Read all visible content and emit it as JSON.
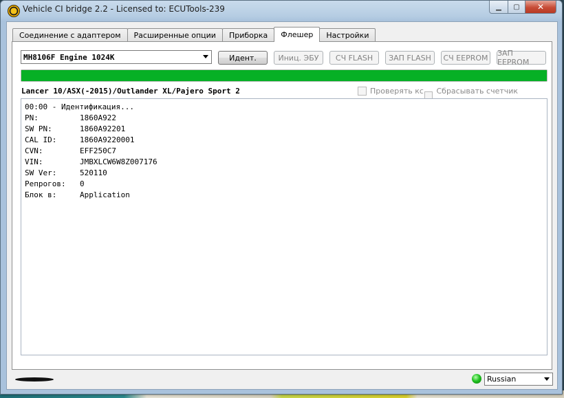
{
  "window": {
    "title": "Vehicle CI bridge  2.2 - Licensed to: ECUTools-239",
    "controls": {
      "minimize": "▁",
      "maximize": "▢",
      "close": "✕"
    }
  },
  "tabs": [
    {
      "label": "Соединение с адаптером",
      "active": false
    },
    {
      "label": "Расширенные опции",
      "active": false
    },
    {
      "label": "Приборка",
      "active": false
    },
    {
      "label": "Флешер",
      "active": true
    },
    {
      "label": "Настройки",
      "active": false
    }
  ],
  "flasher": {
    "ecu_selected": "MH8106F Engine 1024K",
    "buttons": {
      "identify": "Идент.",
      "init_ecu": "Иниц. ЭБУ",
      "read_flash": "СЧ FLASH",
      "write_flash": "ЗАП FLASH",
      "read_eeprom": "СЧ EEPROM",
      "write_eeprom": "ЗАП EEPROM"
    },
    "progress": 1.0,
    "vehicle": "Lancer 10/ASX(-2015)/Outlander XL/Pajero Sport 2",
    "checkboxes": {
      "verify_checksum": "Проверять кс",
      "reset_counter": "Сбрасывать счетчик репрогов"
    },
    "log": {
      "header": "00:00 - Идентификация...",
      "rows": [
        {
          "key": "PN:",
          "value": "1860A922"
        },
        {
          "key": "SW PN:",
          "value": "1860A92201"
        },
        {
          "key": "CAL ID:",
          "value": "1860A9220001"
        },
        {
          "key": "CVN:",
          "value": "EFF250C7"
        },
        {
          "key": "VIN:",
          "value": "JMBXLCW6W8Z007176"
        },
        {
          "key": "SW Ver:",
          "value": "520110"
        },
        {
          "key": "Репрогов:",
          "value": "0"
        },
        {
          "key": "Блок в:",
          "value": "Application"
        }
      ]
    }
  },
  "status": {
    "connection_color": "#22c322",
    "language": "Russian"
  }
}
